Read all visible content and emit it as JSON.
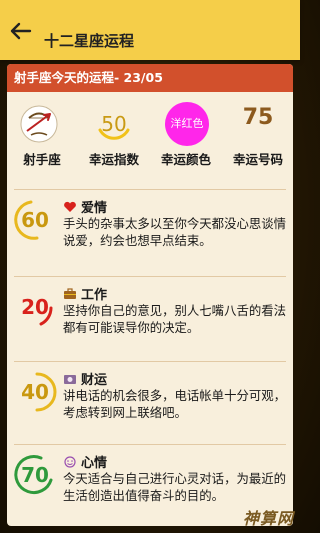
{
  "header": {
    "title": "十二星座运程"
  },
  "card": {
    "heading": "射手座今天的运程- 23/05"
  },
  "stats": {
    "sign_label": "射手座",
    "luck_index": "50",
    "luck_index_label": "幸运指数",
    "lucky_color": "洋红色",
    "lucky_color_hex": "#ff26ea",
    "lucky_color_label": "幸运颜色",
    "lucky_number": "75",
    "lucky_number_label": "幸运号码"
  },
  "sections": [
    {
      "score": "60",
      "score_color": "#e8b81e",
      "icon": "heart-icon",
      "title": "爱情",
      "text": "手头的杂事太多以至你今天都没心思谈情说爱，约会也想早点结束。"
    },
    {
      "score": "20",
      "score_color": "#d8221c",
      "icon": "briefcase-icon",
      "title": "工作",
      "text": "坚持你自己的意见，别人七嘴八舌的看法都有可能误导你的决定。"
    },
    {
      "score": "40",
      "score_color": "#e8b81e",
      "icon": "money-icon",
      "title": "财运",
      "text": "讲电话的机会很多，电话帐单十分可观，考虑转到网上联络吧。"
    },
    {
      "score": "70",
      "score_color": "#2f9a3c",
      "icon": "smiley-icon",
      "title": "心情",
      "text": "今天适合与自己进行心灵对话，为最近的生活创造出值得奋斗的目的。"
    }
  ],
  "watermark": "神算网"
}
